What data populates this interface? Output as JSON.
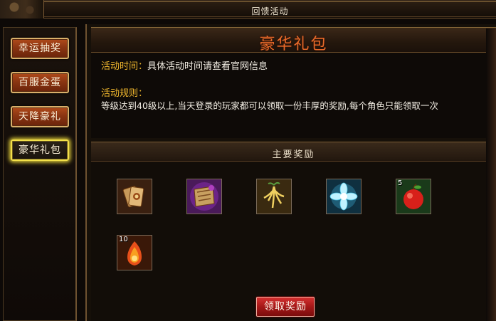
{
  "window": {
    "title": "回馈活动"
  },
  "sidebar": {
    "items": [
      {
        "label": "幸运抽奖",
        "active": false
      },
      {
        "label": "百服金蛋",
        "active": false
      },
      {
        "label": "天降豪礼",
        "active": false
      },
      {
        "label": "豪华礼包",
        "active": true
      }
    ]
  },
  "panel": {
    "title": "豪华礼包",
    "time_label": "活动时间：",
    "time_value": "具体活动时间请查看官网信息",
    "rules_label": "活动规则：",
    "rules_value": "等级达到40级以上,当天登录的玩家都可以领取一份丰厚的奖励,每个角色只能领取一次",
    "rewards_title": "主要奖励",
    "claim_label": "领取奖励"
  },
  "rewards": [
    {
      "icon": "cards-icon",
      "count": ""
    },
    {
      "icon": "purple-scroll-icon",
      "count": ""
    },
    {
      "icon": "golden-root-icon",
      "count": ""
    },
    {
      "icon": "crystal-flower-icon",
      "count": ""
    },
    {
      "icon": "red-apple-icon",
      "count": "5"
    },
    {
      "icon": "fire-orb-icon",
      "count": "10"
    }
  ],
  "colors": {
    "accent_orange": "#e76a2a",
    "label_gold": "#f1b82e",
    "active_glow": "#e6d23a",
    "claim_red": "#a51818"
  }
}
